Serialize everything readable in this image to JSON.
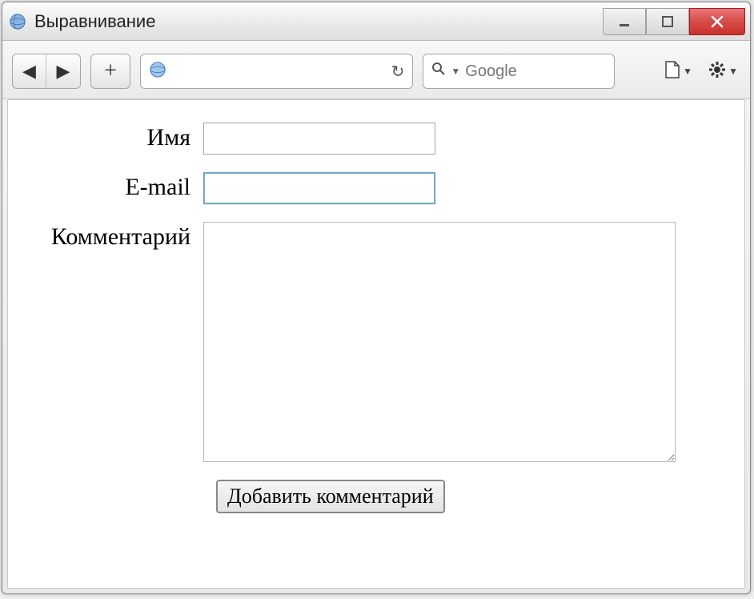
{
  "window": {
    "title": "Выравнивание"
  },
  "toolbar": {
    "address_value": "",
    "search_placeholder": "Google"
  },
  "form": {
    "name_label": "Имя",
    "name_value": "",
    "email_label": "E-mail",
    "email_value": "",
    "comment_label": "Комментарий",
    "comment_value": "",
    "submit_label": "Добавить комментарий"
  }
}
